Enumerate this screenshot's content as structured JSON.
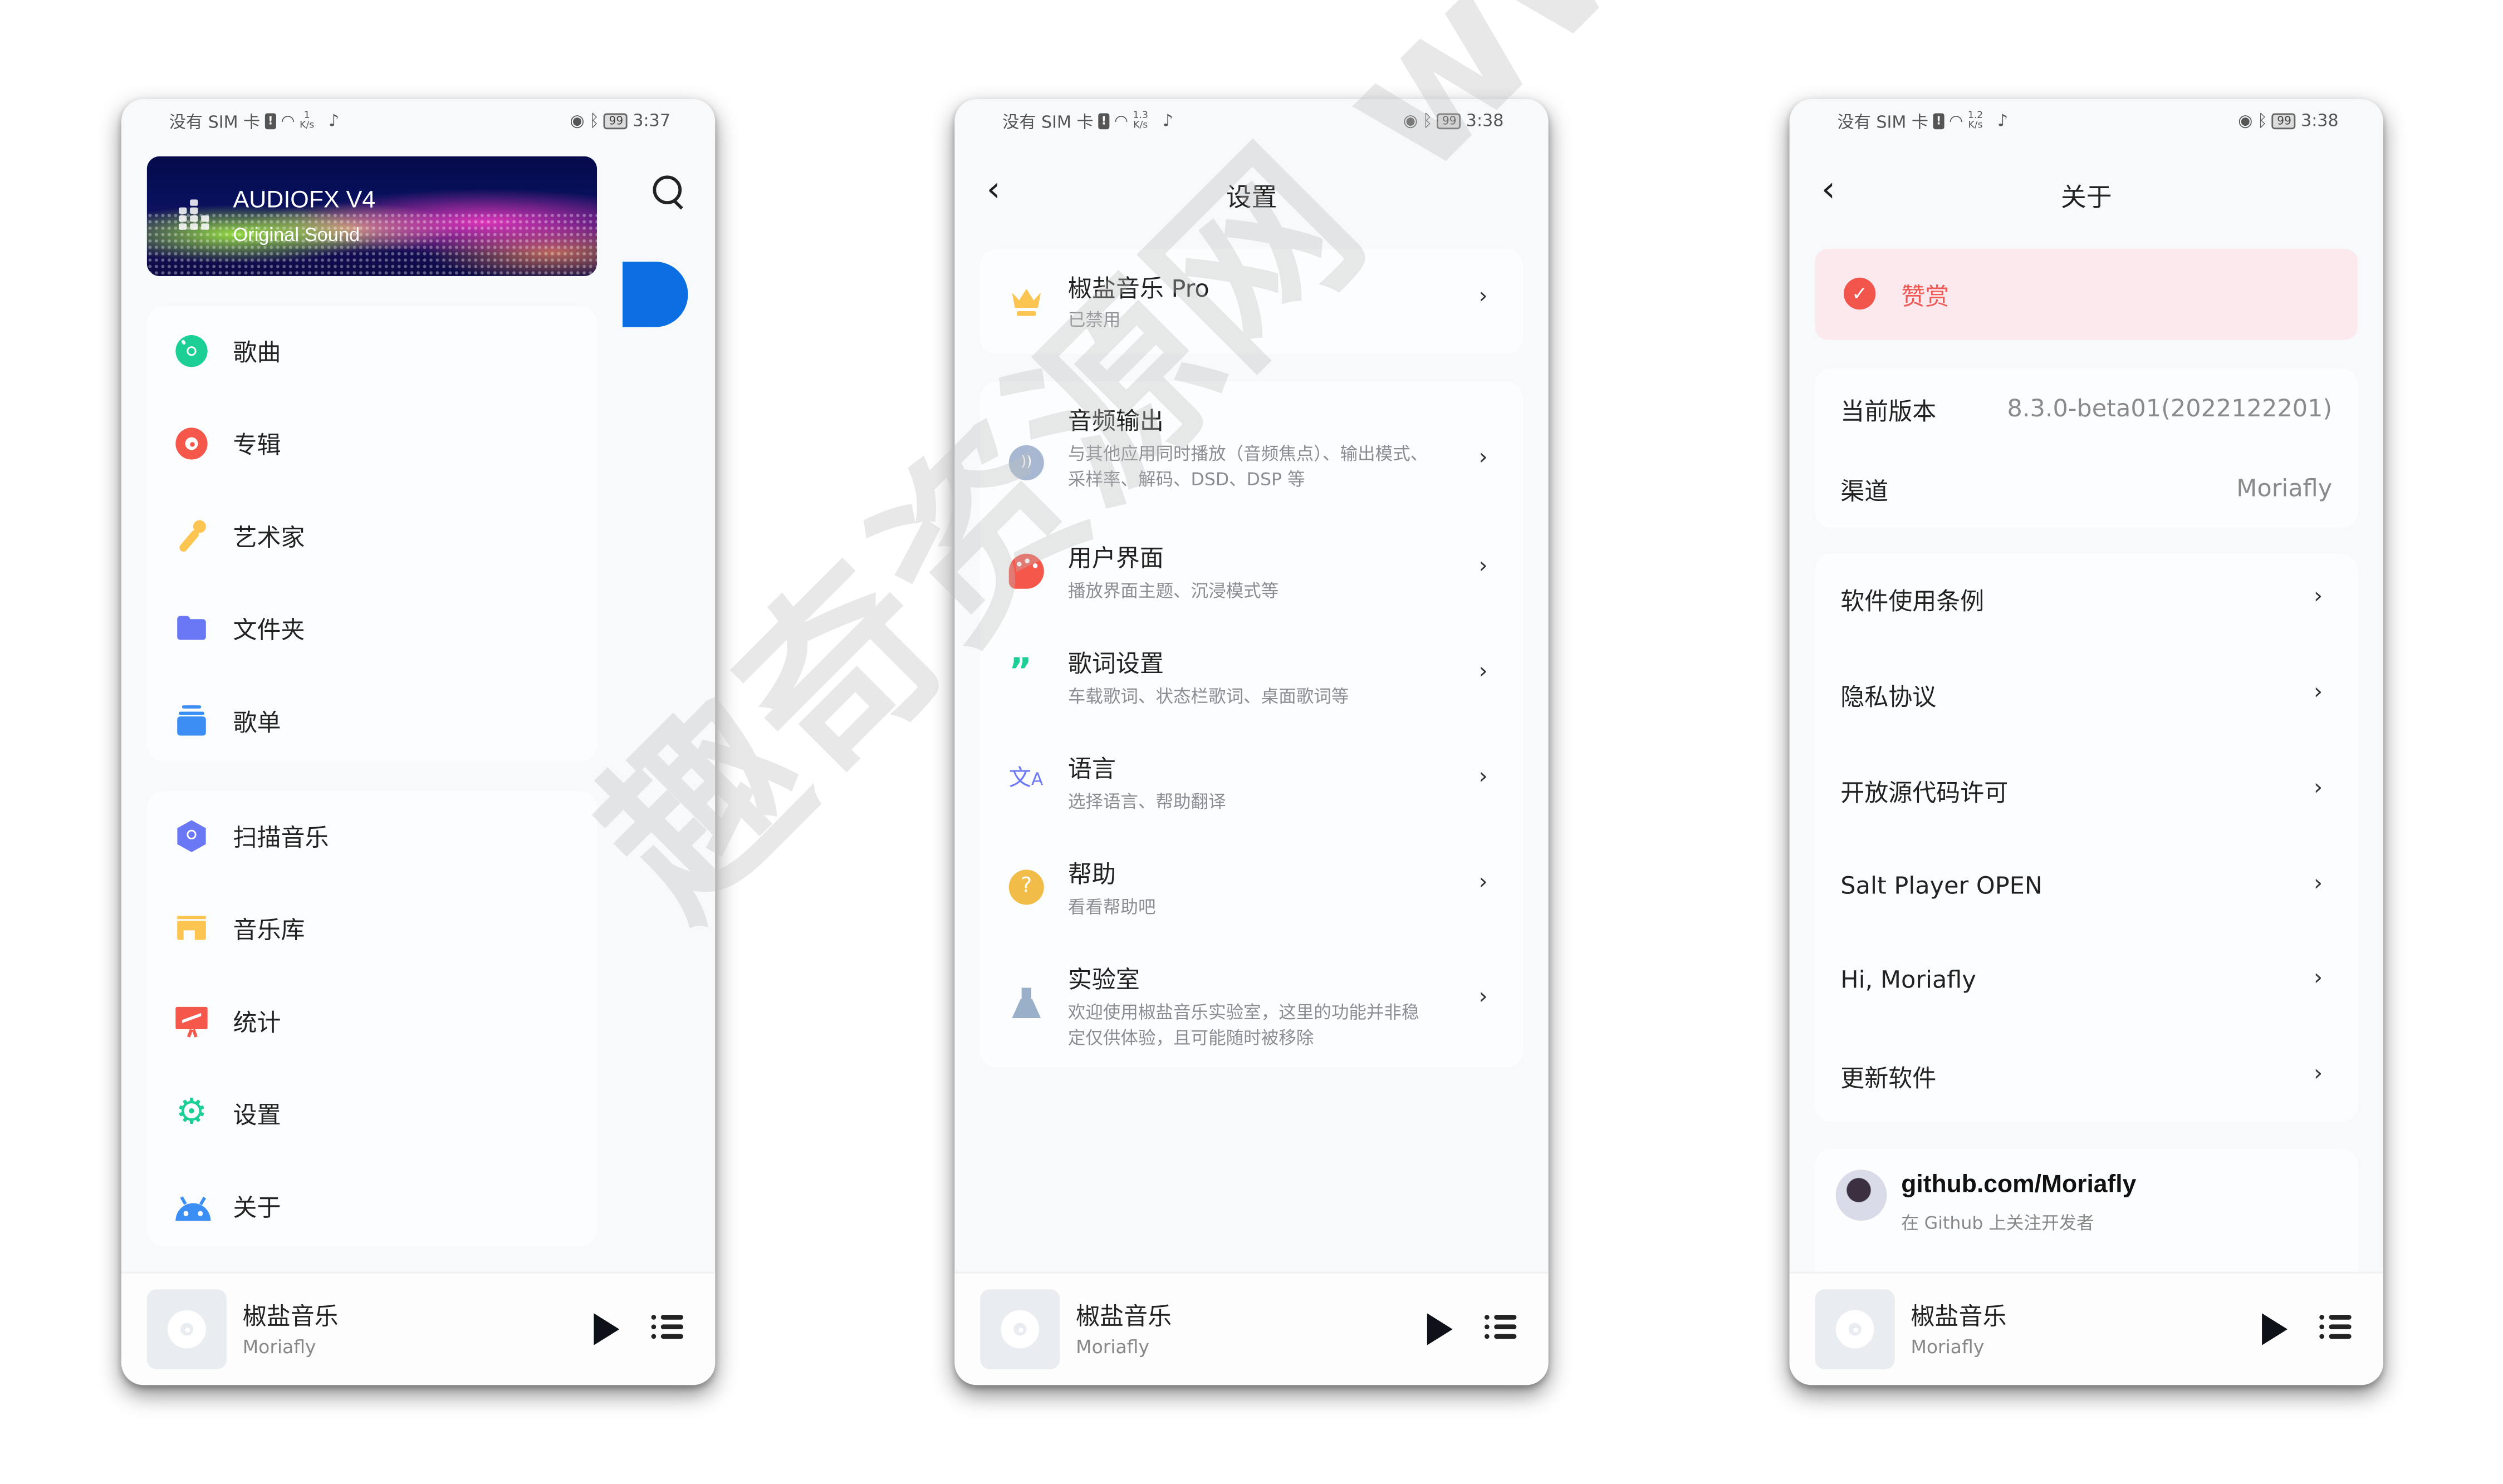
{
  "watermark": "趣奇资源网 www.quqizy.com",
  "screens": [
    {
      "status": {
        "carrier": "没有 SIM 卡",
        "speed_value": "1",
        "speed_unit": "K/s",
        "battery": "99",
        "time": "3:37"
      },
      "banner": {
        "title": "AUDIOFX V4",
        "subtitle": "Original Sound"
      },
      "menu_group_1": [
        {
          "label": "歌曲",
          "icon": "disc-icon",
          "color": "#1ccf94"
        },
        {
          "label": "专辑",
          "icon": "album-icon",
          "color": "#f5574b"
        },
        {
          "label": "艺术家",
          "icon": "microphone-icon",
          "color": "#fcc450"
        },
        {
          "label": "文件夹",
          "icon": "folder-icon",
          "color": "#6a78f5"
        },
        {
          "label": "歌单",
          "icon": "playlist-icon",
          "color": "#3b8ef3"
        }
      ],
      "menu_group_2": [
        {
          "label": "扫描音乐",
          "icon": "scan-cube-icon",
          "color": "#6a78f5"
        },
        {
          "label": "音乐库",
          "icon": "store-icon",
          "color": "#fcc450"
        },
        {
          "label": "统计",
          "icon": "chart-board-icon",
          "color": "#f5574b"
        },
        {
          "label": "设置",
          "icon": "gear-icon",
          "color": "#1ccf94"
        },
        {
          "label": "关于",
          "icon": "android-icon",
          "color": "#3b8ef3"
        }
      ],
      "mini_player": {
        "title": "椒盐音乐",
        "artist": "Moriafly"
      }
    },
    {
      "status": {
        "carrier": "没有 SIM 卡",
        "speed_value": "1.3",
        "speed_unit": "K/s",
        "battery": "99",
        "time": "3:38"
      },
      "title": "设置",
      "pro": {
        "title": "椒盐音乐 Pro",
        "subtitle": "已禁用"
      },
      "items": [
        {
          "title": "音频输出",
          "subtitle": "与其他应用同时播放（音频焦点）、输出模式、采样率、解码、DSD、DSP 等"
        },
        {
          "title": "用户界面",
          "subtitle": "播放界面主题、沉浸模式等"
        },
        {
          "title": "歌词设置",
          "subtitle": "车载歌词、状态栏歌词、桌面歌词等"
        },
        {
          "title": "语言",
          "subtitle": "选择语言、帮助翻译"
        },
        {
          "title": "帮助",
          "subtitle": "看看帮助吧"
        },
        {
          "title": "实验室",
          "subtitle": "欢迎使用椒盐音乐实验室，这里的功能并非稳定仅供体验，且可能随时被移除"
        }
      ],
      "mini_player": {
        "title": "椒盐音乐",
        "artist": "Moriafly"
      }
    },
    {
      "status": {
        "carrier": "没有 SIM 卡",
        "speed_value": "1.2",
        "speed_unit": "K/s",
        "battery": "99",
        "time": "3:38"
      },
      "title": "关于",
      "reward": "赞赏",
      "info": [
        {
          "key": "当前版本",
          "value": "8.3.0-beta01(2022122201)"
        },
        {
          "key": "渠道",
          "value": "Moriafly"
        }
      ],
      "links": [
        "软件使用条例",
        "隐私协议",
        "开放源代码许可",
        "Salt Player OPEN",
        "Hi, Moriafly",
        "更新软件"
      ],
      "github": {
        "title": "github.com/Moriafly",
        "subtitle": "在 Github 上关注开发者"
      },
      "mini_player": {
        "title": "椒盐音乐",
        "artist": "Moriafly"
      }
    }
  ],
  "colors": {
    "accent_blue": "#0b6fe3",
    "reward_bg": "#fbe9ed",
    "reward_text": "#ef5a55"
  }
}
